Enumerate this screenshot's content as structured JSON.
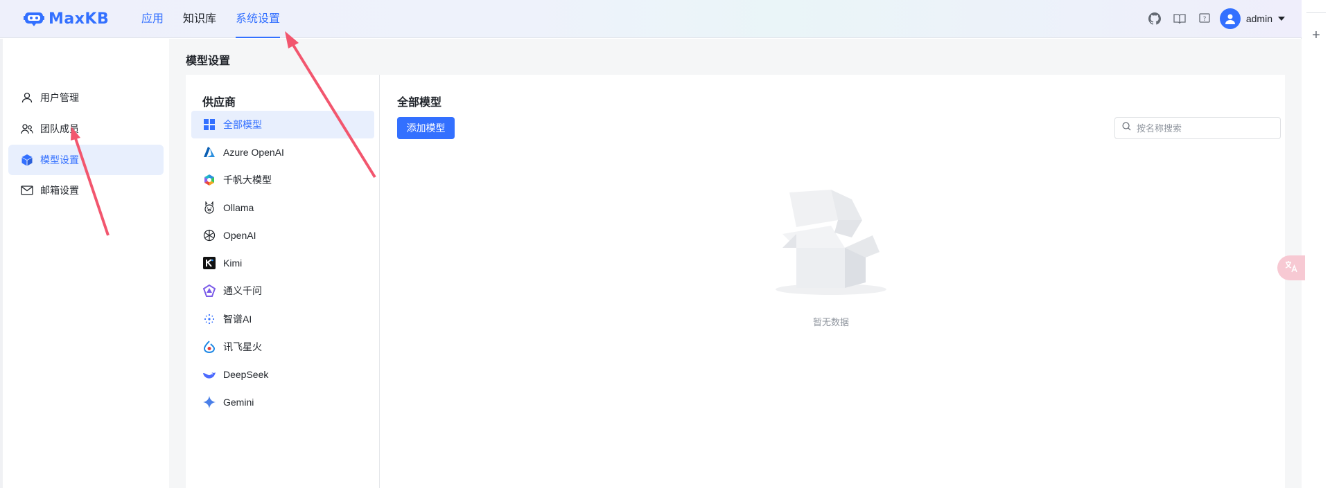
{
  "header": {
    "logo_text": "MaxKB",
    "nav": [
      {
        "label": "应用"
      },
      {
        "label": "知识库"
      },
      {
        "label": "系统设置"
      }
    ],
    "username": "admin"
  },
  "sidebar": {
    "items": [
      {
        "label": "用户管理",
        "icon": "user-icon"
      },
      {
        "label": "团队成员",
        "icon": "team-icon"
      },
      {
        "label": "模型设置",
        "icon": "cube-icon"
      },
      {
        "label": "邮箱设置",
        "icon": "mail-icon"
      }
    ]
  },
  "main": {
    "page_title": "模型设置",
    "providers_title": "供应商",
    "providers": [
      {
        "label": "全部模型"
      },
      {
        "label": "Azure OpenAI"
      },
      {
        "label": "千帆大模型"
      },
      {
        "label": "Ollama"
      },
      {
        "label": "OpenAI"
      },
      {
        "label": "Kimi"
      },
      {
        "label": "通义千问"
      },
      {
        "label": "智谱AI"
      },
      {
        "label": "讯飞星火"
      },
      {
        "label": "DeepSeek"
      },
      {
        "label": "Gemini"
      }
    ],
    "models_title": "全部模型",
    "add_button": "添加模型",
    "search_placeholder": "按名称搜索",
    "empty_text": "暂无数据"
  },
  "colors": {
    "accent": "#3370ff",
    "annotation": "#f2566e"
  }
}
